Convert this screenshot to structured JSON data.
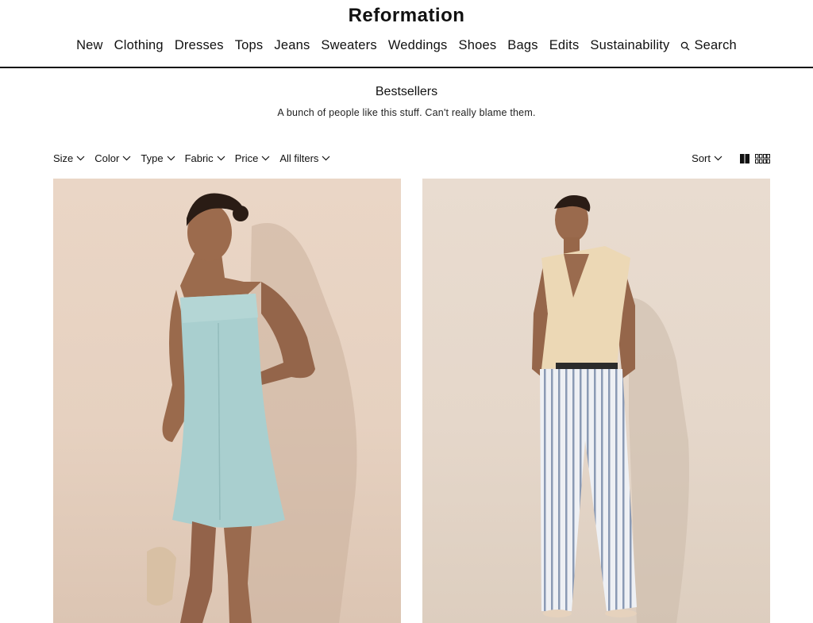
{
  "header": {
    "logo": "Reformation",
    "nav": [
      "New",
      "Clothing",
      "Dresses",
      "Tops",
      "Jeans",
      "Sweaters",
      "Weddings",
      "Shoes",
      "Bags",
      "Edits",
      "Sustainability"
    ],
    "search_label": "Search"
  },
  "page": {
    "title": "Bestsellers",
    "subtitle": "A bunch of people like this stuff. Can't really blame them."
  },
  "filters": [
    "Size",
    "Color",
    "Type",
    "Fabric",
    "Price",
    "All filters"
  ],
  "sort_label": "Sort",
  "icons": {
    "search": "search-icon",
    "chevron": "chevron-down-icon",
    "grid_two": "two-column-grid-icon",
    "grid_four": "four-column-grid-icon"
  },
  "colors": {
    "text": "#111111",
    "background": "#ffffff",
    "product_bg_1": "#e8d4c4",
    "product_bg_2": "#e7dacd",
    "dress": "#a9cfcf",
    "top": "#ecd8b5"
  }
}
